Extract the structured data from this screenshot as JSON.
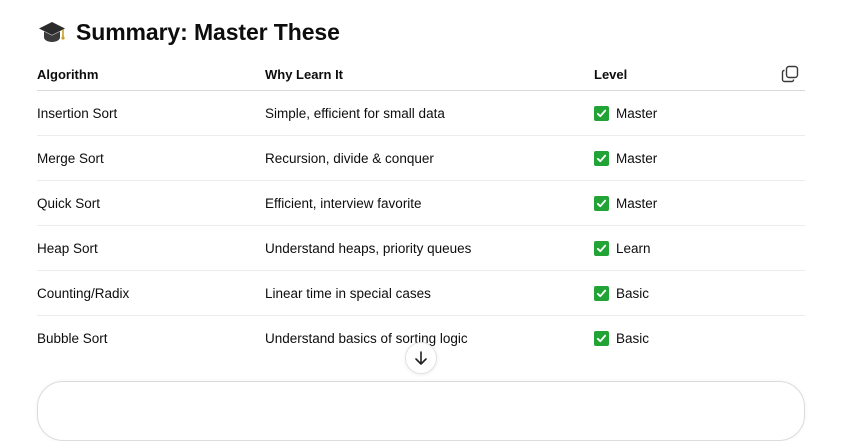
{
  "heading": {
    "icon": "graduation-cap-icon",
    "title": "Summary: Master These"
  },
  "table": {
    "headers": [
      "Algorithm",
      "Why Learn It",
      "Level"
    ],
    "rows": [
      {
        "algorithm": "Insertion Sort",
        "why": "Simple, efficient for small data",
        "level": "Master"
      },
      {
        "algorithm": "Merge Sort",
        "why": "Recursion, divide & conquer",
        "level": "Master"
      },
      {
        "algorithm": "Quick Sort",
        "why": "Efficient, interview favorite",
        "level": "Master"
      },
      {
        "algorithm": "Heap Sort",
        "why": "Understand heaps, priority queues",
        "level": "Learn"
      },
      {
        "algorithm": "Counting/Radix",
        "why": "Linear time in special cases",
        "level": "Basic"
      },
      {
        "algorithm": "Bubble Sort",
        "why": "Understand basics of sorting logic",
        "level": "Basic"
      }
    ],
    "level_icon": "check-mark-button-icon",
    "copy_icon": "copy-icon"
  },
  "controls": {
    "scroll_icon": "arrow-down-icon"
  },
  "colors": {
    "check_green": "#21a336",
    "text": "#0d0d0d",
    "divider": "#ececec"
  }
}
